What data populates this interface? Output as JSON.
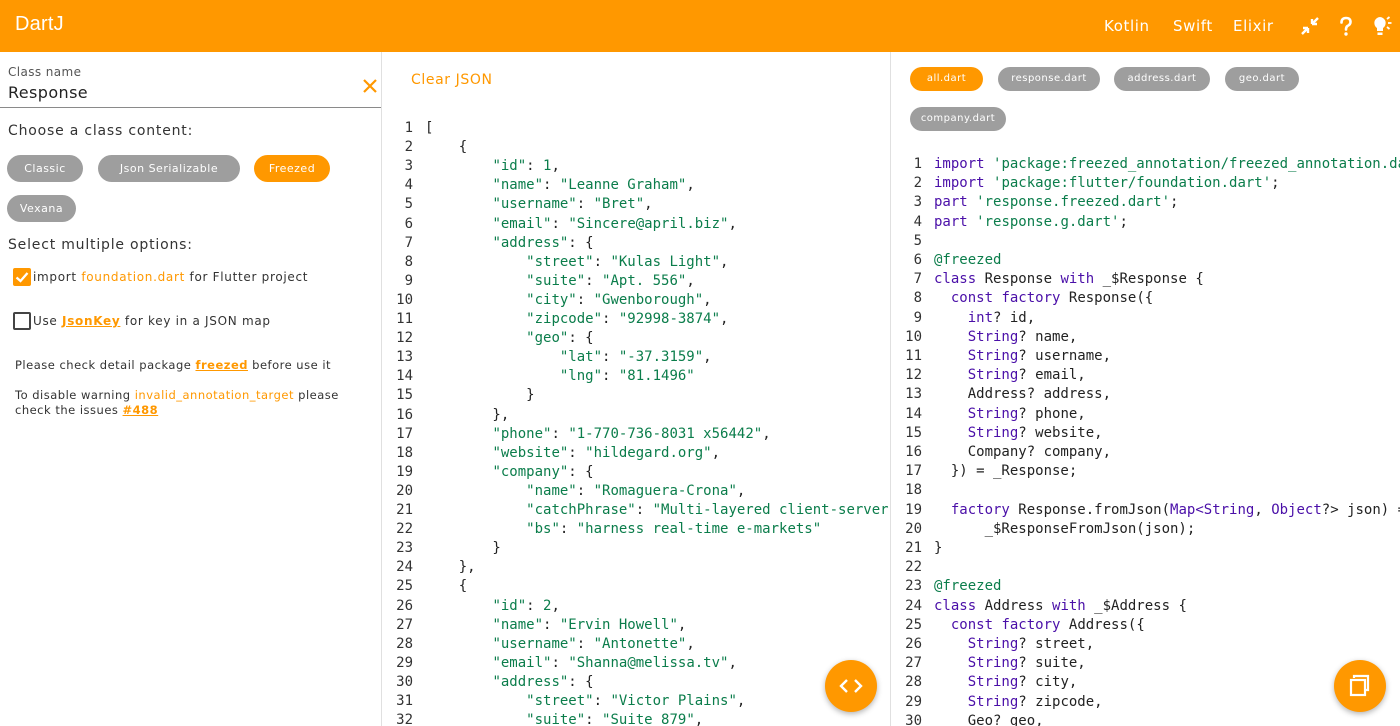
{
  "header": {
    "title": "DartJ",
    "links": [
      "Kotlin",
      "Swift",
      "Elixir"
    ],
    "icons": [
      "collapse-icon",
      "help-icon",
      "lightbulb-icon"
    ]
  },
  "left": {
    "class_name_label": "Class name",
    "class_name_value": "Response",
    "choose_title": "Choose a class content:",
    "chips": [
      "Classic",
      "Json Serializable",
      "Freezed",
      "Vexana"
    ],
    "selected_chip": "Freezed",
    "multi_title": "Select multiple options:",
    "option1": {
      "pre": "import ",
      "hl": "foundation.dart",
      "post": " for Flutter project",
      "checked": true
    },
    "option2": {
      "pre": "Use ",
      "link": "JsonKey",
      "post": " for key in a JSON map",
      "checked": false
    },
    "note1": {
      "pre": "Please check detail package ",
      "link": "freezed",
      "post": " before use it"
    },
    "note2": {
      "pre": "To disable warning ",
      "hl": "invalid_annotation_target",
      "post": " please",
      "line2_pre": "check the issues ",
      "link": "#488"
    }
  },
  "middle": {
    "clear_label": "Clear JSON",
    "json_lines": [
      "[",
      "    {",
      "        \"id\": 1,",
      "        \"name\": \"Leanne Graham\",",
      "        \"username\": \"Bret\",",
      "        \"email\": \"Sincere@april.biz\",",
      "        \"address\": {",
      "            \"street\": \"Kulas Light\",",
      "            \"suite\": \"Apt. 556\",",
      "            \"city\": \"Gwenborough\",",
      "            \"zipcode\": \"92998-3874\",",
      "            \"geo\": {",
      "                \"lat\": \"-37.3159\",",
      "                \"lng\": \"81.1496\"",
      "            }",
      "        },",
      "        \"phone\": \"1-770-736-8031 x56442\",",
      "        \"website\": \"hildegard.org\",",
      "        \"company\": {",
      "            \"name\": \"Romaguera-Crona\",",
      "            \"catchPhrase\": \"Multi-layered client-server neural-net\",",
      "            \"bs\": \"harness real-time e-markets\"",
      "        }",
      "    },",
      "    {",
      "        \"id\": 2,",
      "        \"name\": \"Ervin Howell\",",
      "        \"username\": \"Antonette\",",
      "        \"email\": \"Shanna@melissa.tv\",",
      "        \"address\": {",
      "            \"street\": \"Victor Plains\",",
      "            \"suite\": \"Suite 879\","
    ]
  },
  "right": {
    "file_tabs": [
      "all.dart",
      "response.dart",
      "address.dart",
      "geo.dart",
      "company.dart"
    ],
    "selected_tab": "all.dart",
    "code_lines": [
      "import 'package:freezed_annotation/freezed_annotation.dart';",
      "import 'package:flutter/foundation.dart';",
      "part 'response.freezed.dart';",
      "part 'response.g.dart';",
      "",
      "@freezed",
      "class Response with _$Response {",
      "  const factory Response({",
      "    int? id,",
      "    String? name,",
      "    String? username,",
      "    String? email,",
      "    Address? address,",
      "    String? phone,",
      "    String? website,",
      "    Company? company,",
      "  }) = _Response;",
      "",
      "  factory Response.fromJson(Map<String, Object?> json) =>",
      "      _$ResponseFromJson(json);",
      "}",
      "",
      "@freezed",
      "class Address with _$Address {",
      "  const factory Address({",
      "    String? street,",
      "    String? suite,",
      "    String? city,",
      "    String? zipcode,",
      "    Geo? geo,"
    ]
  },
  "colors": {
    "accent": "#ff9800",
    "chip_inactive": "#9e9e9e",
    "string": "#0b7d4b",
    "keyword": "#4a0fa8"
  }
}
